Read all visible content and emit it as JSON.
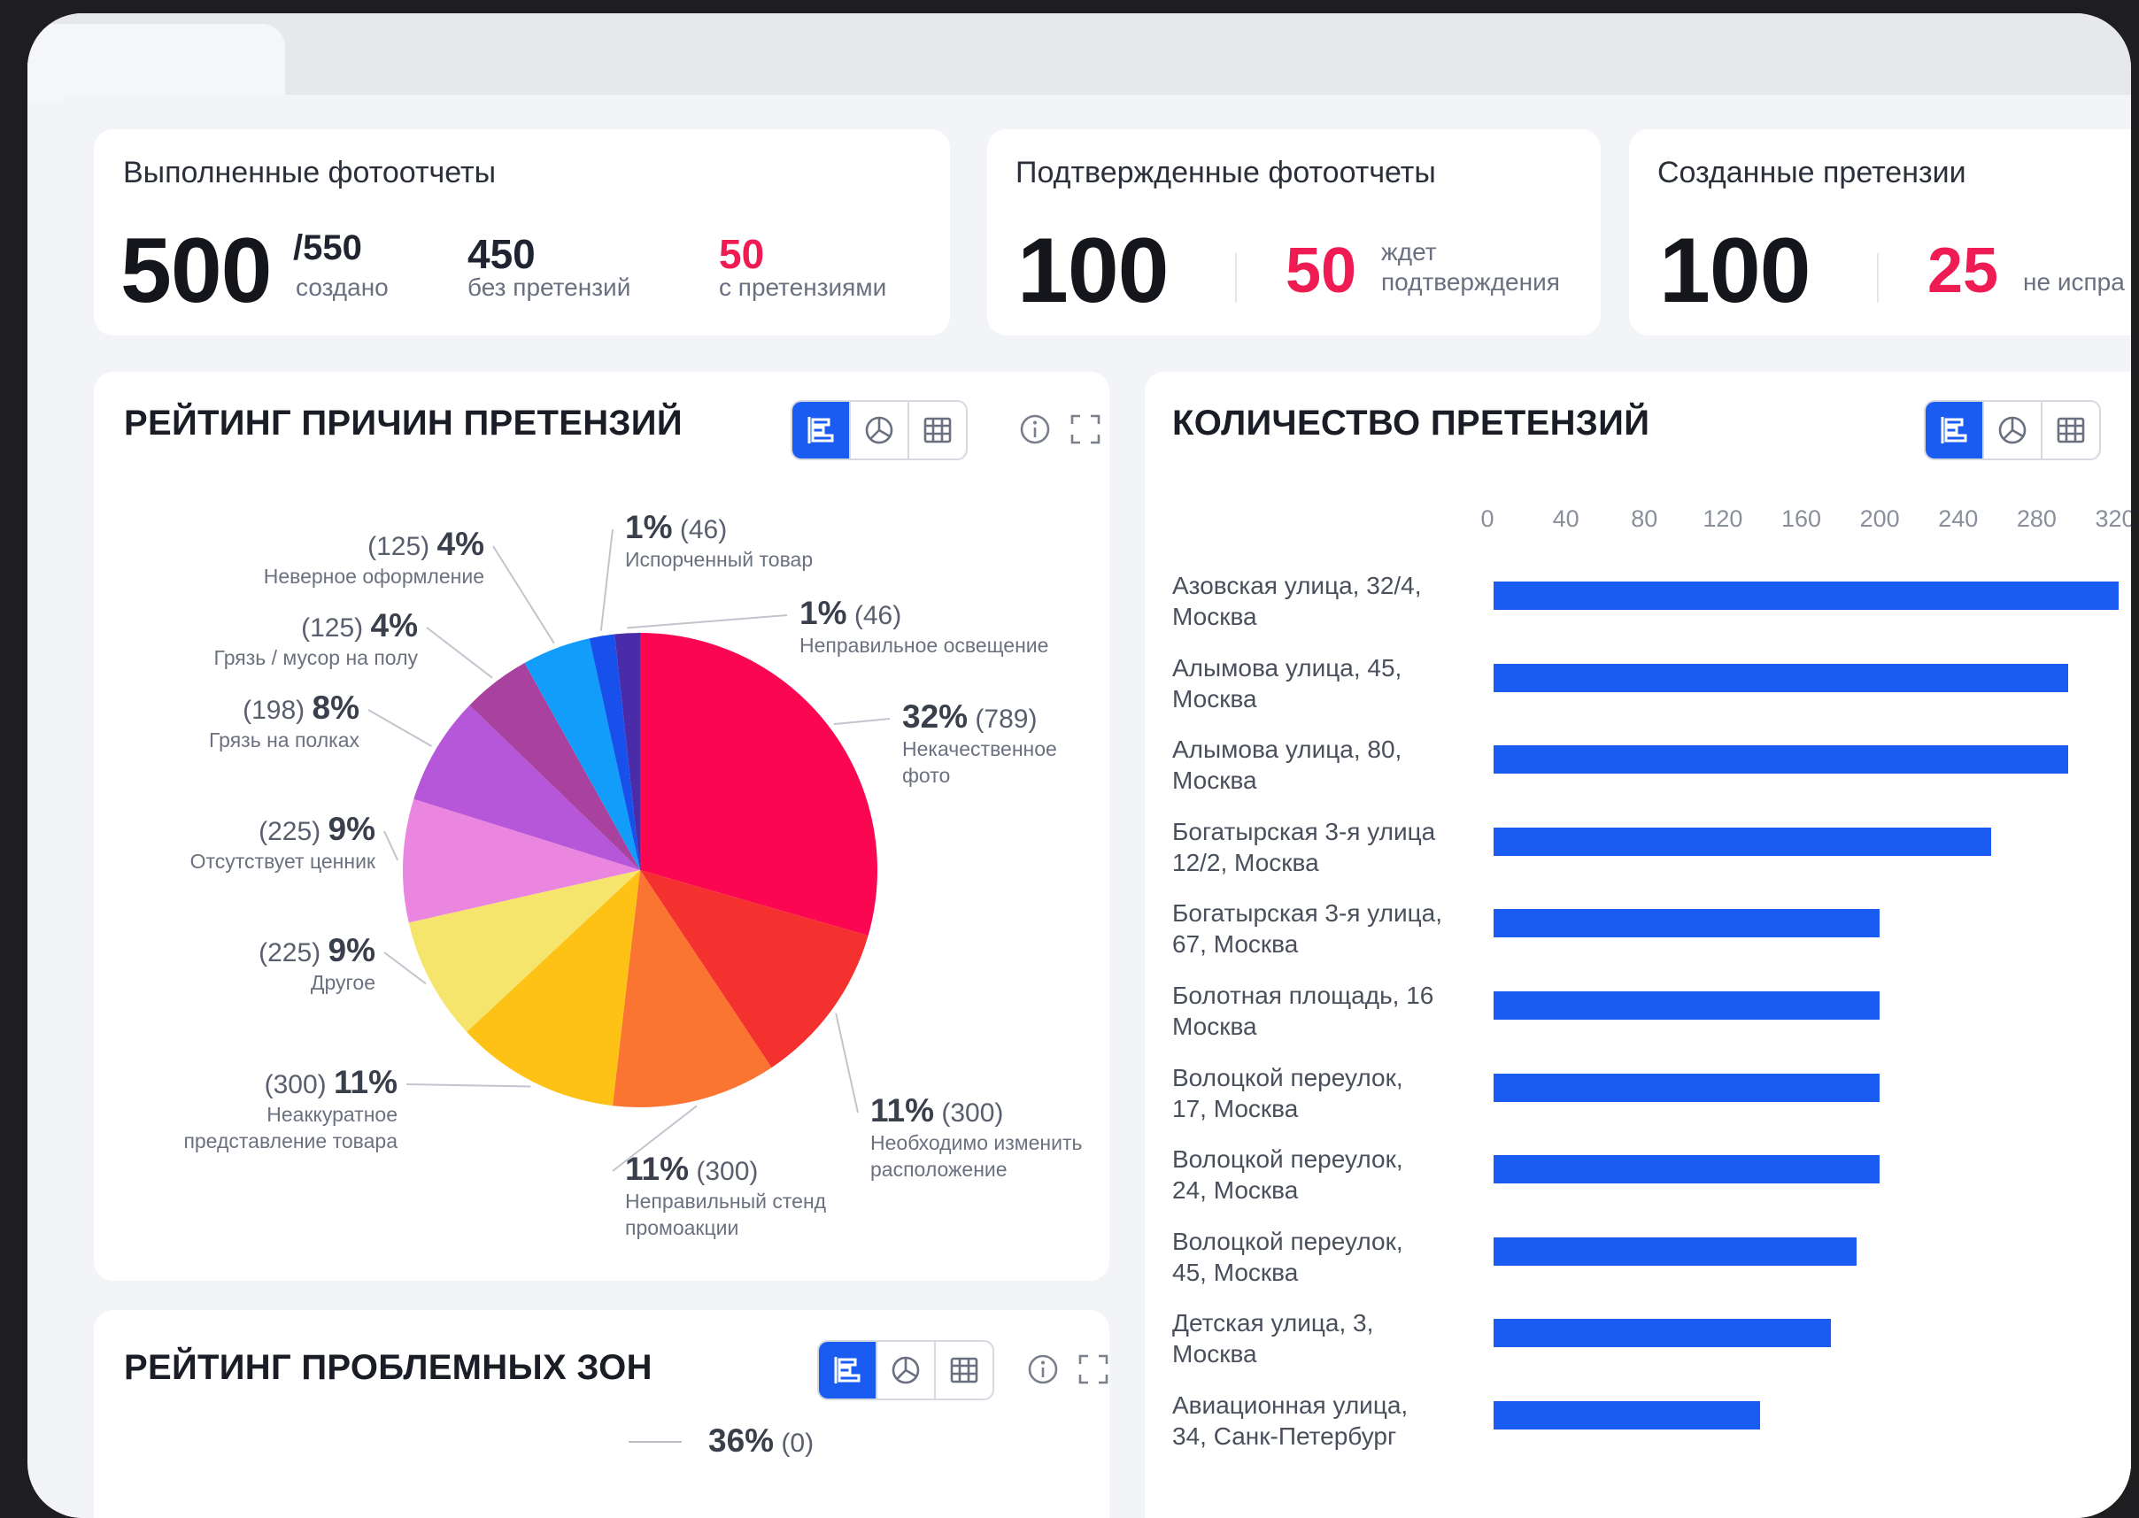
{
  "kpi": {
    "completed": {
      "title": "Выполненные фотоотчеты",
      "value": "500",
      "total": "/550",
      "total_label": "создано",
      "no_claims_value": "450",
      "no_claims_label": "без претензий",
      "with_claims_value": "50",
      "with_claims_label": "с претензиями"
    },
    "confirmed": {
      "title": "Подтвержденные фотоотчеты",
      "value": "100",
      "pending_value": "50",
      "pending_label_1": "ждет",
      "pending_label_2": "подтверждения"
    },
    "created": {
      "title": "Созданные претензии",
      "value": "100",
      "unfixed_value": "25",
      "unfixed_label": "не испра"
    }
  },
  "sections": {
    "reasons_title": "РЕЙТИНГ ПРИЧИН ПРЕТЕНЗИЙ",
    "count_title": "КОЛИЧЕСТВО ПРЕТЕНЗИЙ",
    "zones_title": "РЕЙТИНГ ПРОБЛЕМНЫХ ЗОН"
  },
  "zones_preview": {
    "pct": "36%",
    "count": "(0)"
  },
  "colors": {
    "accent": "#1a5cf2",
    "red": "#ee1c53"
  },
  "icons": [
    "bar-chart-icon",
    "pie-chart-icon",
    "table-icon",
    "info-icon",
    "expand-icon"
  ],
  "chart_data": [
    {
      "type": "pie",
      "title": "РЕЙТИНГ ПРИЧИН ПРЕТЕНЗИЙ",
      "slices": [
        {
          "label": "Некачественное фото",
          "label_lines": "Некачественное\nфото",
          "pct": "32%",
          "count": "(789)",
          "value": 789,
          "color": "#fb0651"
        },
        {
          "label": "Необходимо изменить расположение",
          "label_lines": "Необходимо изменить\nрасположение",
          "pct": "11%",
          "count": "(300)",
          "value": 300,
          "color": "#f4312e"
        },
        {
          "label": "Неправильный стенд промоакции",
          "label_lines": "Неправильный стенд\nпромоакции",
          "pct": "11%",
          "count": "(300)",
          "value": 300,
          "color": "#fa7432"
        },
        {
          "label": "Неаккуратное представление товара",
          "label_lines": "Неаккуратное\nпредставление товара",
          "pct": "11%",
          "count": "(300)",
          "value": 300,
          "color": "#fdc215"
        },
        {
          "label": "Другое",
          "label_lines": "Другое",
          "pct": "9%",
          "count": "(225)",
          "value": 225,
          "color": "#f6e56d"
        },
        {
          "label": "Отсутствует ценник",
          "label_lines": "Отсутствует ценник",
          "pct": "9%",
          "count": "(225)",
          "value": 225,
          "color": "#eb86e0"
        },
        {
          "label": "Грязь на полках",
          "label_lines": "Грязь на полках",
          "pct": "8%",
          "count": "(198)",
          "value": 198,
          "color": "#b656d8"
        },
        {
          "label": "Грязь / мусор на полу",
          "label_lines": "Грязь / мусор на полу",
          "pct": "4%",
          "count": "(125)",
          "value": 125,
          "color": "#a9419e"
        },
        {
          "label": "Неверное оформление",
          "label_lines": "Неверное оформление",
          "pct": "4%",
          "count": "(125)",
          "value": 125,
          "color": "#139dfa"
        },
        {
          "label": "Испорченный товар",
          "label_lines": "Испорченный товар",
          "pct": "1%",
          "count": "(46)",
          "value": 46,
          "color": "#1750eb"
        },
        {
          "label": "Неправильное освещение",
          "label_lines": "Неправильное освещение",
          "pct": "1%",
          "count": "(46)",
          "value": 46,
          "color": "#4b2ca8"
        }
      ]
    },
    {
      "type": "bar",
      "orientation": "horizontal",
      "title": "КОЛИЧЕСТВО ПРЕТЕНЗИЙ",
      "xlim": [
        0,
        320
      ],
      "ticks": [
        "0",
        "40",
        "80",
        "120",
        "160",
        "200",
        "240",
        "280",
        "320"
      ],
      "categories": [
        "Азовская улица, 32/4,\nМосква",
        "Алымова улица, 45,\nМосква",
        "Алымова улица, 80,\nМосква",
        "Богатырская 3-я улица\n12/2, Москва",
        "Богатырская 3-я улица,\n67, Москва",
        "Болотная площадь, 16\nМосква",
        "Волоцкой переулок,\n17, Москва",
        "Волоцкой переулок,\n24, Москва",
        "Волоцкой переулок,\n45, Москва",
        "Детская улица, 3,\nМосква",
        "Авиационная улица,\n34, Санк-Петербург"
      ],
      "values": [
        322,
        296,
        296,
        257,
        200,
        200,
        200,
        200,
        188,
        175,
        139
      ],
      "color": "#1a5cf2"
    }
  ]
}
